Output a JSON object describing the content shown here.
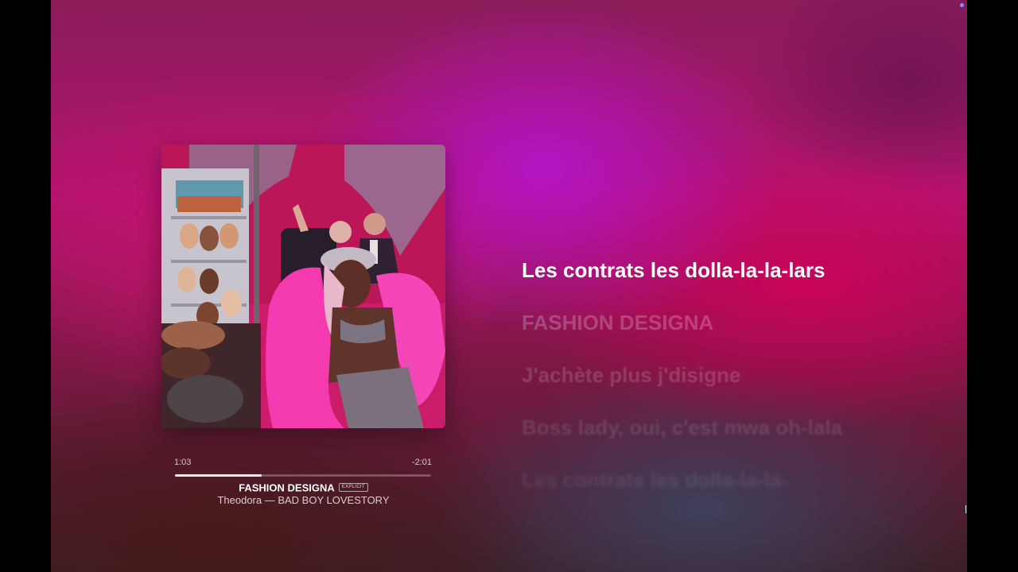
{
  "playback": {
    "elapsed": "1:03",
    "remaining": "-2:01",
    "progress_percent": 34
  },
  "track": {
    "title": "FASHION DESIGNA",
    "explicit_label": "EXPLICIT",
    "subtitle": "Theodora — BAD BOY LOVESTORY"
  },
  "lyrics": [
    {
      "text": "Les contrats les dolla-la-la-lars",
      "state": "active"
    },
    {
      "text": "FASHION DESIGNA",
      "state": "upcoming"
    },
    {
      "text": "J'achète plus j'disigne",
      "state": "upcoming"
    },
    {
      "text": "Boss lady, oui, c'est mwa oh-lala",
      "state": "upcoming"
    },
    {
      "text": "Les contrats les dolla-la-la-",
      "state": "upcoming"
    }
  ],
  "colors": {
    "accent_magenta": "#b3136e",
    "accent_purple": "#b414c8",
    "text_primary": "#ffffff"
  }
}
